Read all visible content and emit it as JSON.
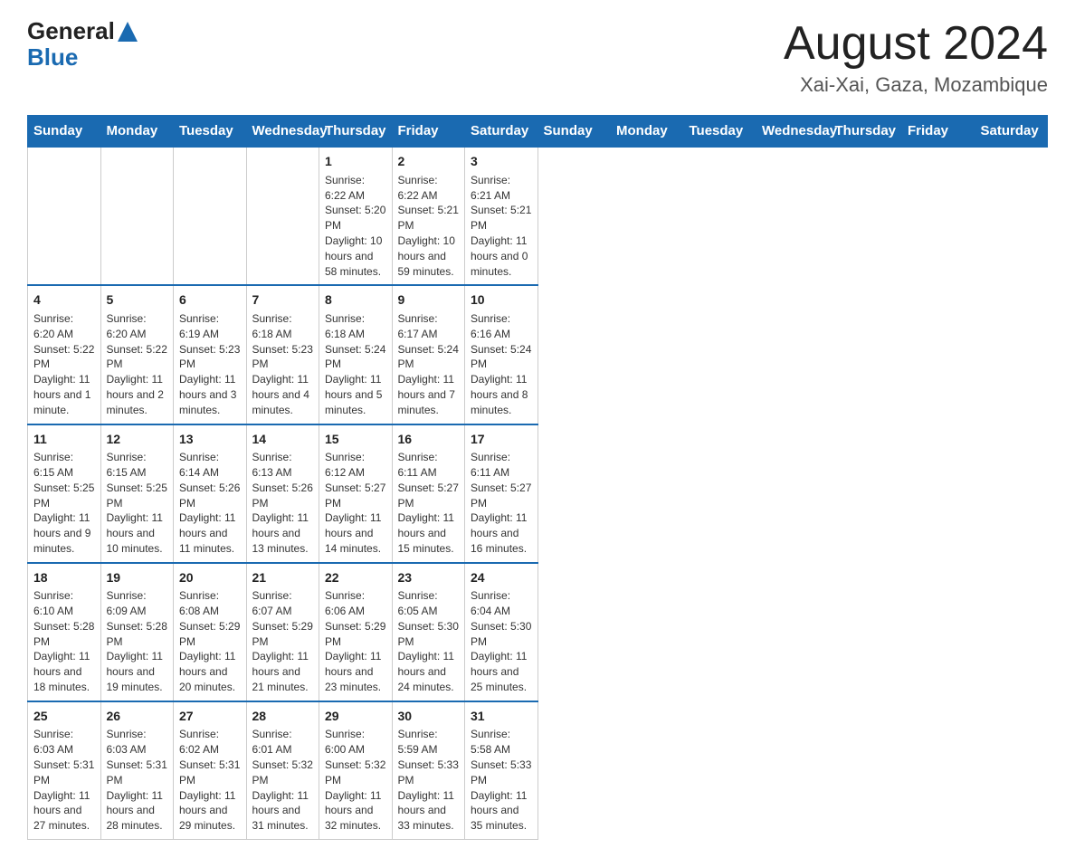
{
  "header": {
    "logo_general": "General",
    "logo_blue": "Blue",
    "month_year": "August 2024",
    "location": "Xai-Xai, Gaza, Mozambique"
  },
  "days_of_week": [
    "Sunday",
    "Monday",
    "Tuesday",
    "Wednesday",
    "Thursday",
    "Friday",
    "Saturday"
  ],
  "weeks": [
    [
      {
        "day": "",
        "info": ""
      },
      {
        "day": "",
        "info": ""
      },
      {
        "day": "",
        "info": ""
      },
      {
        "day": "",
        "info": ""
      },
      {
        "day": "1",
        "info": "Sunrise: 6:22 AM\nSunset: 5:20 PM\nDaylight: 10 hours and 58 minutes."
      },
      {
        "day": "2",
        "info": "Sunrise: 6:22 AM\nSunset: 5:21 PM\nDaylight: 10 hours and 59 minutes."
      },
      {
        "day": "3",
        "info": "Sunrise: 6:21 AM\nSunset: 5:21 PM\nDaylight: 11 hours and 0 minutes."
      }
    ],
    [
      {
        "day": "4",
        "info": "Sunrise: 6:20 AM\nSunset: 5:22 PM\nDaylight: 11 hours and 1 minute."
      },
      {
        "day": "5",
        "info": "Sunrise: 6:20 AM\nSunset: 5:22 PM\nDaylight: 11 hours and 2 minutes."
      },
      {
        "day": "6",
        "info": "Sunrise: 6:19 AM\nSunset: 5:23 PM\nDaylight: 11 hours and 3 minutes."
      },
      {
        "day": "7",
        "info": "Sunrise: 6:18 AM\nSunset: 5:23 PM\nDaylight: 11 hours and 4 minutes."
      },
      {
        "day": "8",
        "info": "Sunrise: 6:18 AM\nSunset: 5:24 PM\nDaylight: 11 hours and 5 minutes."
      },
      {
        "day": "9",
        "info": "Sunrise: 6:17 AM\nSunset: 5:24 PM\nDaylight: 11 hours and 7 minutes."
      },
      {
        "day": "10",
        "info": "Sunrise: 6:16 AM\nSunset: 5:24 PM\nDaylight: 11 hours and 8 minutes."
      }
    ],
    [
      {
        "day": "11",
        "info": "Sunrise: 6:15 AM\nSunset: 5:25 PM\nDaylight: 11 hours and 9 minutes."
      },
      {
        "day": "12",
        "info": "Sunrise: 6:15 AM\nSunset: 5:25 PM\nDaylight: 11 hours and 10 minutes."
      },
      {
        "day": "13",
        "info": "Sunrise: 6:14 AM\nSunset: 5:26 PM\nDaylight: 11 hours and 11 minutes."
      },
      {
        "day": "14",
        "info": "Sunrise: 6:13 AM\nSunset: 5:26 PM\nDaylight: 11 hours and 13 minutes."
      },
      {
        "day": "15",
        "info": "Sunrise: 6:12 AM\nSunset: 5:27 PM\nDaylight: 11 hours and 14 minutes."
      },
      {
        "day": "16",
        "info": "Sunrise: 6:11 AM\nSunset: 5:27 PM\nDaylight: 11 hours and 15 minutes."
      },
      {
        "day": "17",
        "info": "Sunrise: 6:11 AM\nSunset: 5:27 PM\nDaylight: 11 hours and 16 minutes."
      }
    ],
    [
      {
        "day": "18",
        "info": "Sunrise: 6:10 AM\nSunset: 5:28 PM\nDaylight: 11 hours and 18 minutes."
      },
      {
        "day": "19",
        "info": "Sunrise: 6:09 AM\nSunset: 5:28 PM\nDaylight: 11 hours and 19 minutes."
      },
      {
        "day": "20",
        "info": "Sunrise: 6:08 AM\nSunset: 5:29 PM\nDaylight: 11 hours and 20 minutes."
      },
      {
        "day": "21",
        "info": "Sunrise: 6:07 AM\nSunset: 5:29 PM\nDaylight: 11 hours and 21 minutes."
      },
      {
        "day": "22",
        "info": "Sunrise: 6:06 AM\nSunset: 5:29 PM\nDaylight: 11 hours and 23 minutes."
      },
      {
        "day": "23",
        "info": "Sunrise: 6:05 AM\nSunset: 5:30 PM\nDaylight: 11 hours and 24 minutes."
      },
      {
        "day": "24",
        "info": "Sunrise: 6:04 AM\nSunset: 5:30 PM\nDaylight: 11 hours and 25 minutes."
      }
    ],
    [
      {
        "day": "25",
        "info": "Sunrise: 6:03 AM\nSunset: 5:31 PM\nDaylight: 11 hours and 27 minutes."
      },
      {
        "day": "26",
        "info": "Sunrise: 6:03 AM\nSunset: 5:31 PM\nDaylight: 11 hours and 28 minutes."
      },
      {
        "day": "27",
        "info": "Sunrise: 6:02 AM\nSunset: 5:31 PM\nDaylight: 11 hours and 29 minutes."
      },
      {
        "day": "28",
        "info": "Sunrise: 6:01 AM\nSunset: 5:32 PM\nDaylight: 11 hours and 31 minutes."
      },
      {
        "day": "29",
        "info": "Sunrise: 6:00 AM\nSunset: 5:32 PM\nDaylight: 11 hours and 32 minutes."
      },
      {
        "day": "30",
        "info": "Sunrise: 5:59 AM\nSunset: 5:33 PM\nDaylight: 11 hours and 33 minutes."
      },
      {
        "day": "31",
        "info": "Sunrise: 5:58 AM\nSunset: 5:33 PM\nDaylight: 11 hours and 35 minutes."
      }
    ]
  ]
}
